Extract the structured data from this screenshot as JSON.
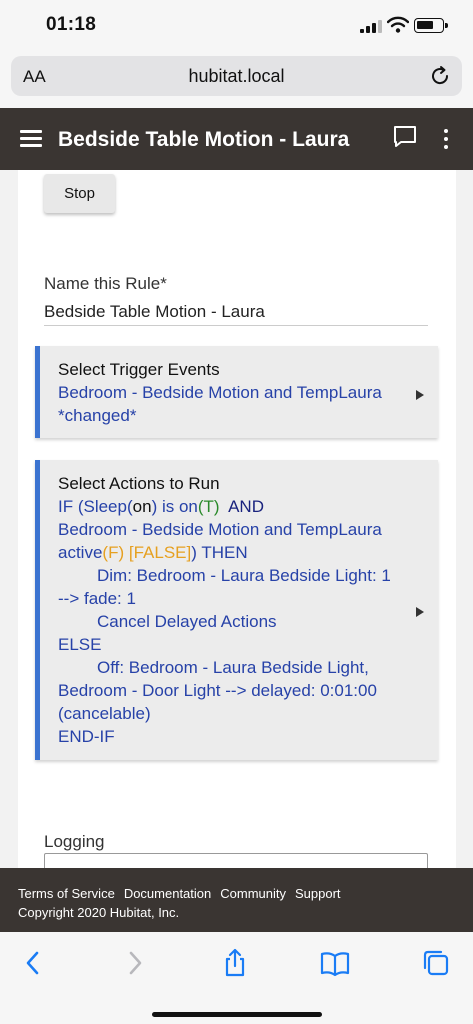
{
  "status_bar": {
    "time": "01:18"
  },
  "browser": {
    "text_size_label": "AA",
    "url": "hubitat.local"
  },
  "header": {
    "title": "Bedside Table Motion - Laura"
  },
  "rule": {
    "stop_label": "Stop",
    "name_label": "Name this Rule*",
    "name_value": "Bedside Table Motion - Laura",
    "trigger": {
      "heading": "Select Trigger Events",
      "line1": "Bedroom - Bedside Motion and TempLaura",
      "line2": "*changed*"
    },
    "actions": {
      "heading": "Select Actions to Run",
      "if_kw": "IF (Sleep(",
      "if_on": "on",
      "if_mid": ") is on",
      "if_t": "(T)",
      "if_and": "AND",
      "line_dev": "Bedroom - Bedside Motion and TempLaura",
      "active": "active",
      "f_paren": "(F)",
      "false_tag": "[FALSE]",
      "then_kw": ") THEN",
      "dim_line": "Dim: Bedroom - Laura Bedside Light: 1",
      "fade_line": "--> fade: 1",
      "cancel_line": "Cancel Delayed Actions",
      "else_kw": "ELSE",
      "off_line": "Off: Bedroom - Laura Bedside Light,",
      "door_line": "Bedroom - Door Light --> delayed: 0:01:00",
      "cancelable": "(cancelable)",
      "endif": "END-IF"
    },
    "logging_label": "Logging"
  },
  "footer": {
    "links": [
      "Terms of Service",
      "Documentation",
      "Community",
      "Support"
    ],
    "copyright": "Copyright 2020 Hubitat, Inc."
  },
  "colors": {
    "header_bg": "#3a3532",
    "accent_bar": "#3b73d0",
    "link_blue": "#2742a8",
    "true_green": "#2a8a2a",
    "false_orange": "#e6a020",
    "ios_blue": "#1a7cf5"
  },
  "icons": {
    "menu": "hamburger-icon",
    "chat": "chat-bubble-icon",
    "more": "more-vertical-icon",
    "reload": "reload-icon",
    "back": "back-chevron-icon",
    "forward": "forward-chevron-icon",
    "share": "share-icon",
    "bookmarks": "book-icon",
    "tabs": "tabs-icon"
  }
}
